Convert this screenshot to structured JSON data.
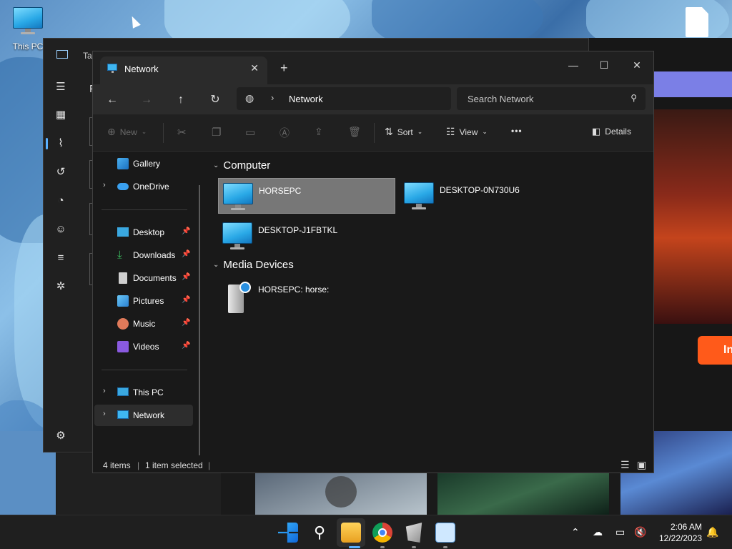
{
  "desktop": {
    "icons": [
      {
        "label": "This PC"
      }
    ]
  },
  "background_window": {
    "title_partial": "Tas",
    "header_partial": "F"
  },
  "web_page": {
    "button_partial": "In"
  },
  "explorer": {
    "tab_title": "Network",
    "tab_close": "✕",
    "new_tab": "+",
    "window_controls": {
      "minimize": "—",
      "maximize": "☐",
      "close": "✕"
    },
    "address": {
      "crumb": "Network",
      "separator": "›"
    },
    "search": {
      "placeholder": "Search Network"
    },
    "toolbar": {
      "new_label": "New",
      "sort_label": "Sort",
      "view_label": "View",
      "more_label": "•••",
      "details_label": "Details"
    },
    "nav_pane": {
      "top_items": [
        {
          "label": "Gallery"
        },
        {
          "label": "OneDrive"
        }
      ],
      "quick_access": [
        {
          "label": "Desktop"
        },
        {
          "label": "Downloads"
        },
        {
          "label": "Documents"
        },
        {
          "label": "Pictures"
        },
        {
          "label": "Music"
        },
        {
          "label": "Videos"
        }
      ],
      "bottom_items": [
        {
          "label": "This PC"
        },
        {
          "label": "Network"
        }
      ]
    },
    "groups": [
      {
        "title": "Computer",
        "items": [
          {
            "label": "HORSEPC",
            "selected": true
          },
          {
            "label": "DESKTOP-0N730U6"
          },
          {
            "label": "DESKTOP-J1FBTKL"
          }
        ]
      },
      {
        "title": "Media Devices",
        "items": [
          {
            "label": "HORSEPC: horse:"
          }
        ]
      }
    ],
    "status": {
      "count": "4 items",
      "selection": "1 item selected"
    }
  },
  "taskbar": {
    "clock_time": "2:06 AM",
    "clock_date": "12/22/2023"
  },
  "colors": {
    "accent": "#5ab0ff",
    "selection": "#777777",
    "window_bg": "#191919"
  }
}
